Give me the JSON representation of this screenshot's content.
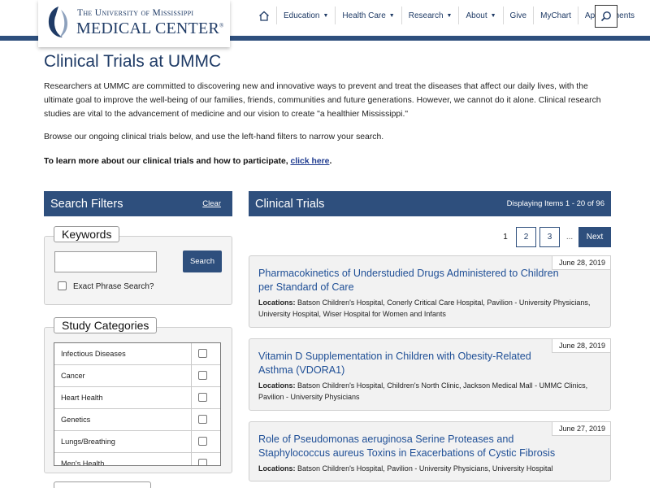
{
  "header": {
    "logo_line1": "The University of Mississippi",
    "logo_line2": "MEDICAL CENTER",
    "logo_trademark": "®",
    "nav": [
      {
        "label": "Education",
        "dropdown": true
      },
      {
        "label": "Health Care",
        "dropdown": true
      },
      {
        "label": "Research",
        "dropdown": true
      },
      {
        "label": "About",
        "dropdown": true
      },
      {
        "label": "Give",
        "dropdown": false
      },
      {
        "label": "MyChart",
        "dropdown": false
      },
      {
        "label": "Appointments",
        "dropdown": false
      }
    ],
    "icons": {
      "home": "home-icon",
      "search": "search-icon"
    },
    "colors": {
      "brand": "#2e4f7d",
      "link": "#1f4f96"
    }
  },
  "page": {
    "title": "Clinical Trials at UMMC",
    "intro": "Researchers at UMMC are committed to discovering new and innovative ways to prevent and treat the diseases that affect our daily lives, with the ultimate goal to improve the well-being of our families, friends, communities and future generations. However, we cannot do it alone. Clinical research studies are vital to the advancement of medicine and our vision to create \"a healthier Mississippi.\"",
    "browse": "Browse our ongoing clinical trials below, and use the left-hand filters to narrow your search.",
    "learn_prefix": "To learn more about our clinical trials and how to participate, ",
    "learn_link": "click here",
    "learn_suffix": "."
  },
  "filters": {
    "title": "Search Filters",
    "clear": "Clear",
    "keywords_legend": "Keywords",
    "keyword_value": "",
    "search_button": "Search",
    "exact_phrase": "Exact Phrase Search?",
    "categories_legend": "Study Categories",
    "categories": [
      "Infectious Diseases",
      "Cancer",
      "Heart Health",
      "Genetics",
      "Lungs/Breathing",
      "Men's Health"
    ]
  },
  "trials": {
    "title": "Clinical Trials",
    "display_info": "Displaying Items 1 - 20 of 96",
    "pagination": {
      "current": "1",
      "pages": [
        "2",
        "3"
      ],
      "ellipsis": "...",
      "next": "Next"
    },
    "locations_label": "Locations:",
    "items": [
      {
        "date": "June 28, 2019",
        "title": "Pharmacokinetics of Understudied Drugs Administered to Children per Standard of Care",
        "locations": "Batson Children's Hospital, Conerly Critical Care Hospital, Pavilion - University Physicians, University Hospital, Wiser Hospital for Women and Infants"
      },
      {
        "date": "June 28, 2019",
        "title": "Vitamin D Supplementation in Children with Obesity-Related Asthma (VDORA1)",
        "locations": "Batson Children's Hospital, Children's North Clinic, Jackson Medical Mall - UMMC Clinics, Pavilion - University Physicians"
      },
      {
        "date": "June 27, 2019",
        "title": "Role of Pseudomonas aeruginosa Serine Proteases and Staphylococcus aureus Toxins in Exacerbations of Cystic Fibrosis",
        "locations": "Batson Children's Hospital, Pavilion - University Physicians, University Hospital"
      }
    ]
  }
}
